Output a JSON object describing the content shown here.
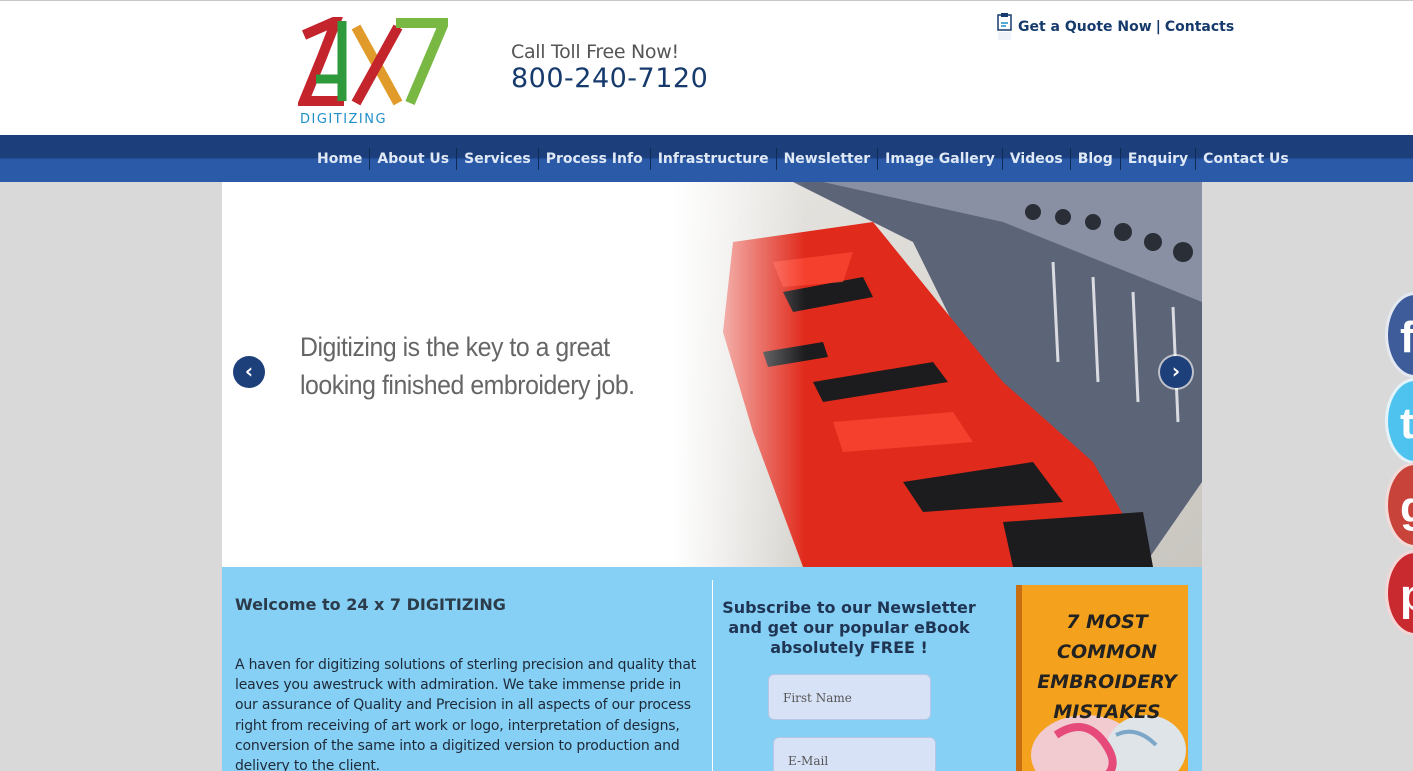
{
  "header": {
    "logo_text": "DIGITIZING",
    "call_label": "Call Toll Free Now!",
    "call_number": "800-240-7120",
    "quote_link": "Get a Quote Now",
    "separator": "|",
    "contacts_link": "Contacts"
  },
  "nav": {
    "items": [
      "Home",
      "About Us",
      "Services",
      "Process Info",
      "Infrastructure",
      "Newsletter",
      "Image Gallery",
      "Videos",
      "Blog",
      "Enquiry",
      "Contact Us"
    ]
  },
  "slider": {
    "line1": "Digitizing is the key to a great",
    "line2": "looking finished embroidery job.",
    "prev_icon": "‹",
    "next_icon": "›"
  },
  "welcome": {
    "title": "Welcome to 24 x 7 DIGITIZING",
    "text": "A haven for digitizing solutions of sterling precision and quality that leaves you awestruck with admiration. We take immense pride in our assurance of Quality and Precision in all aspects of our process right from receiving of art work or logo, interpretation of designs, conversion of the same into a digitized version to production and delivery to the client."
  },
  "newsletter": {
    "title": "Subscribe to our Newsletter and get our popular eBook absolutely FREE !",
    "first_name_placeholder": "First Name",
    "email_placeholder": "E-Mail"
  },
  "ebook": {
    "title_line1": "7 MOST COMMON",
    "title_line2": "EMBROIDERY",
    "title_line3": "MISTAKES"
  },
  "social": {
    "facebook": "f",
    "twitter": "t",
    "googleplus": "g+",
    "pinterest": "p"
  },
  "colors": {
    "nav_dark": "#1c3f7c",
    "nav_light": "#2a5aa8",
    "content_bg": "#86cff5",
    "brand_navy": "#163a6c"
  }
}
